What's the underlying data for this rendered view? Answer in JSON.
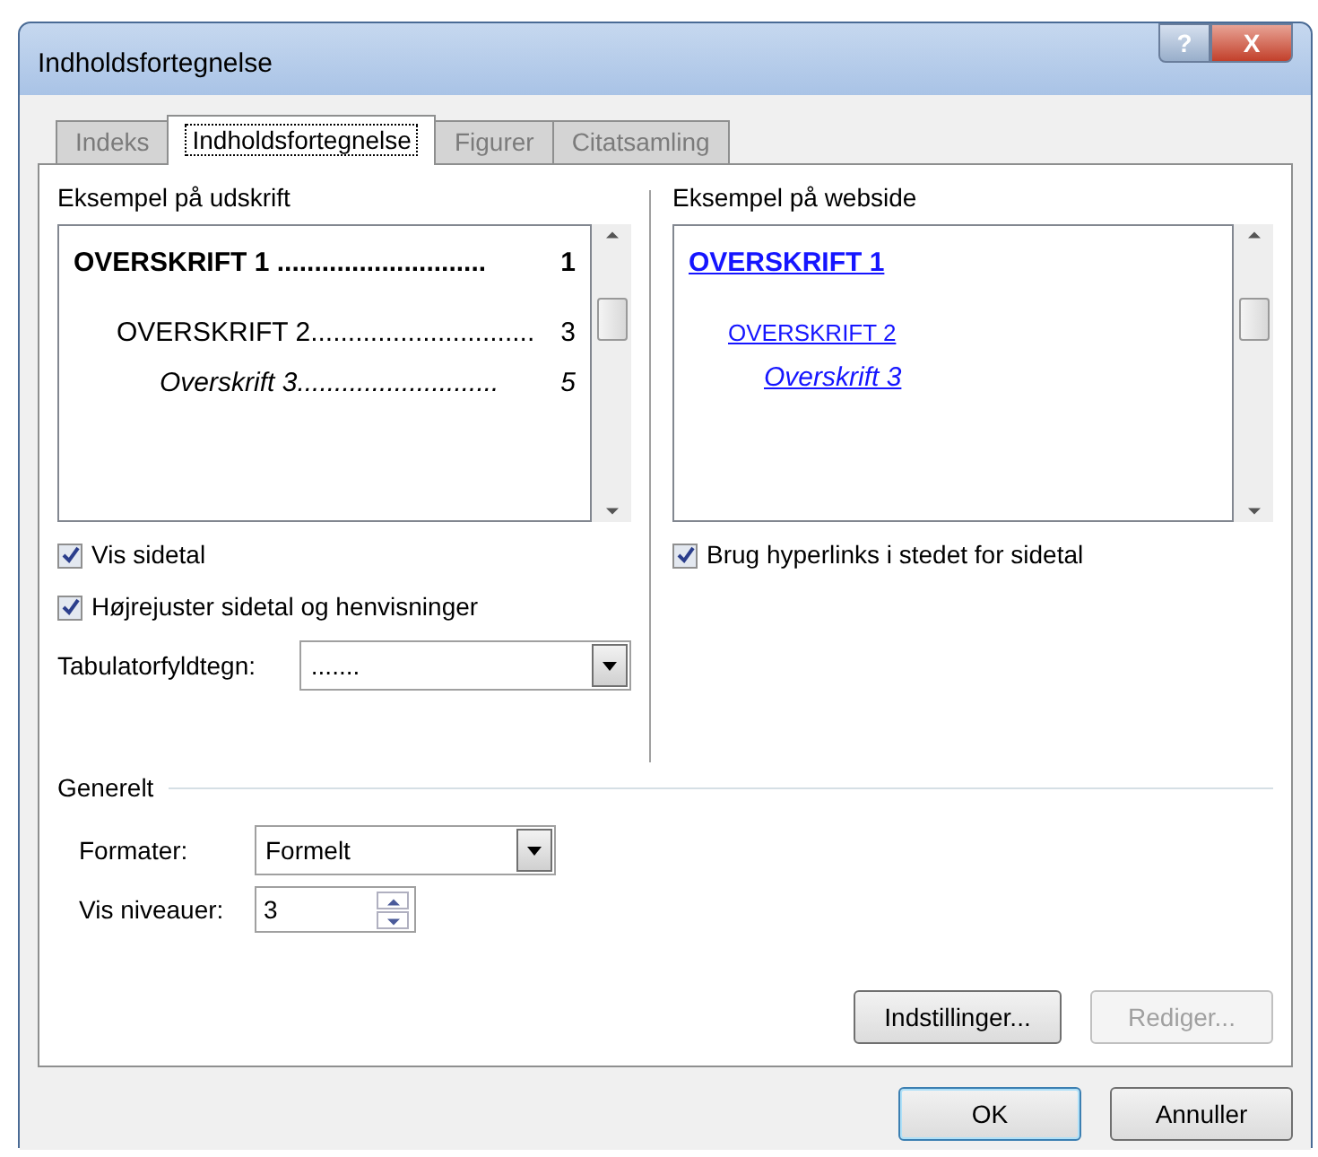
{
  "window": {
    "title": "Indholdsfortegnelse",
    "buttons": [
      "?",
      "X"
    ]
  },
  "tabs": [
    {
      "label": "Indeks",
      "selected": false
    },
    {
      "label": "Indholdsfortegnelse",
      "selected": true
    },
    {
      "label": "Figurer",
      "selected": false
    },
    {
      "label": "Citatsamling",
      "selected": false
    }
  ],
  "print_preview": {
    "label": "Eksempel på udskrift",
    "entries": [
      {
        "title": "OVERSKRIFT 1 ",
        "leader": "............................",
        "page": "1",
        "children": [
          {
            "title": "OVERSKRIFT 2",
            "leader": "..............................",
            "page": "3",
            "children": [
              {
                "title": "Overskrift 3",
                "leader": "...........................",
                "page": "5"
              }
            ]
          }
        ]
      }
    ]
  },
  "print_options": [
    {
      "label": "Vis sidetal",
      "checked": true
    },
    {
      "label": "Højrejuster sidetal og henvisninger",
      "checked": true
    }
  ],
  "tab_leader": {
    "label": "Tabulatorfyldtegn:",
    "value": "......."
  },
  "web_preview": {
    "label": "Eksempel på webside",
    "entries": [
      {
        "title": "OVERSKRIFT 1",
        "children": [
          {
            "title": "OVERSKRIFT 2",
            "children": [
              {
                "title": "Overskrift 3"
              }
            ]
          }
        ]
      }
    ]
  },
  "web_options": [
    {
      "label": "Brug hyperlinks i stedet for sidetal",
      "checked": true
    }
  ],
  "general": {
    "label": "Generelt",
    "format": {
      "label": "Formater:",
      "value": "Formelt"
    },
    "levels": {
      "label": "Vis niveauer:",
      "value": "3"
    }
  },
  "panel_buttons": [
    {
      "label": "Indstillinger...",
      "disabled": false
    },
    {
      "label": "Rediger...",
      "disabled": true
    }
  ],
  "dialog_buttons": [
    {
      "label": "OK",
      "default": true
    },
    {
      "label": "Annuller",
      "default": false
    }
  ]
}
